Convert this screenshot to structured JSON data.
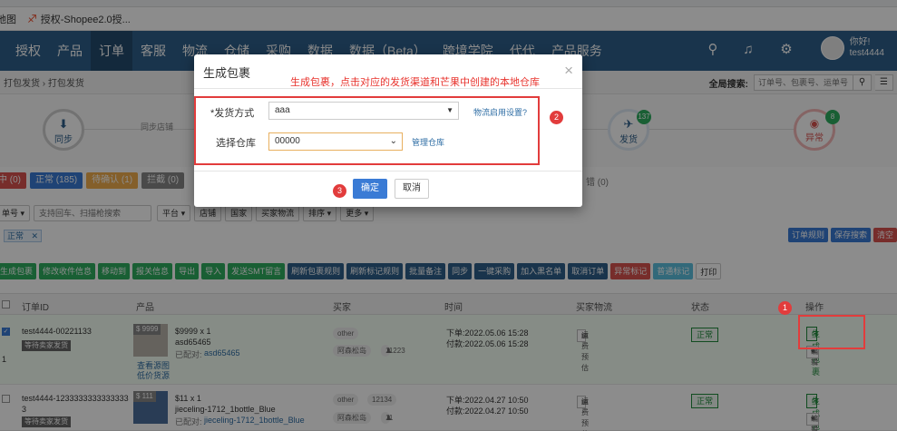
{
  "browser": {
    "bookmarks": [
      {
        "label": "地图"
      },
      {
        "label": "授权-Shopee2.0授..."
      }
    ]
  },
  "nav": {
    "items": [
      "授权",
      "产品",
      "订单",
      "客服",
      "物流",
      "仓储",
      "采购",
      "数据",
      "数据（Beta）",
      "跨境学院",
      "代代",
      "产品服务"
    ],
    "active_index": 2,
    "greeting": "你好!",
    "username": "test4444"
  },
  "breadcrumb": {
    "text": "打包发货 › 打包发货"
  },
  "global_search": {
    "label": "全局搜索:",
    "placeholder": "订单号、包裹号、运单号"
  },
  "workflow": {
    "step1_label": "同步",
    "step1_link": "同步店铺",
    "ship_label": "发货",
    "ship_count": "137",
    "abnormal_label": "异常",
    "abnormal_count": "8"
  },
  "status_tabs": [
    {
      "label": "中 (0)",
      "color": "#d9534f"
    },
    {
      "label": "正常 (185)",
      "color": "#3a7bd5"
    },
    {
      "label": "待确认 (1)",
      "color": "#f0ad4e"
    },
    {
      "label": "拦截 (0)",
      "color": "#888888"
    }
  ],
  "status_tab_right": "错 (0)",
  "filters": {
    "search_placeholder": "支持回车、扫描枪搜索",
    "prefix": "单号",
    "buttons": [
      "平台",
      "店铺",
      "国家",
      "买家物流",
      "排序",
      "更多"
    ],
    "active_tag": "正常"
  },
  "right_buttons": [
    {
      "label": "订单规则",
      "color": "#3a7bd5"
    },
    {
      "label": "保存搜索",
      "color": "#3a7bd5"
    },
    {
      "label": "清空",
      "color": "#d9534f"
    }
  ],
  "actions": [
    {
      "label": "生成包裹",
      "color": "#2eae60"
    },
    {
      "label": "修改收件信息",
      "color": "#2eae60"
    },
    {
      "label": "移动到",
      "color": "#2eae60"
    },
    {
      "label": "报关信息",
      "color": "#2eae60"
    },
    {
      "label": "导出",
      "color": "#2eae60"
    },
    {
      "label": "导入",
      "color": "#2eae60"
    },
    {
      "label": "发送SMT留言",
      "color": "#2eae60"
    },
    {
      "label": "刷新包裹规则",
      "color": "#2e5f8a"
    },
    {
      "label": "刷新标记规则",
      "color": "#2e5f8a"
    },
    {
      "label": "批量备注",
      "color": "#2e5f8a"
    },
    {
      "label": "同步",
      "color": "#2e5f8a"
    },
    {
      "label": "一键采购",
      "color": "#2e5f8a"
    },
    {
      "label": "加入黑名单",
      "color": "#2e5f8a"
    },
    {
      "label": "取消订单",
      "color": "#2e5f8a"
    },
    {
      "label": "异常标记",
      "color": "#d9534f"
    },
    {
      "label": "普通标记",
      "color": "#5bc0de"
    },
    {
      "label": "打印",
      "color": "#ffffff"
    }
  ],
  "table": {
    "headers": [
      "订单ID",
      "产品",
      "买家",
      "时间",
      "买家物流",
      "状态",
      "操作"
    ],
    "rows": [
      {
        "order_id": "test4444-00221133",
        "status_label": "等待卖家发货",
        "price_tag": "$ 9999",
        "price_qty": "$9999 x 1",
        "sku": "asd65465",
        "matched": "已配对:",
        "matched_sku": "asd65465",
        "source1": "查看源图",
        "source2": "低价货源",
        "buyer": "other",
        "buyer_extra": "",
        "buyer_name": "阿森松岛",
        "buyer_count": "11223",
        "order_time": "下单:2022.05.06 15:28",
        "pay_time": "付款:2022.05.06 15:28",
        "shipping": "运费预估",
        "state": "正常",
        "op_primary": "生成包裹",
        "op_secondary": "编辑"
      },
      {
        "order_id": "test4444-1233333333333333",
        "order_id_tail": "3",
        "status_label": "等待卖家发货",
        "price_tag": "$ 111",
        "price_qty": "$11 x 1",
        "sku": "jieceling-1712_1bottle_Blue",
        "matched": "已配对:",
        "matched_sku": "jieceling-1712_1bottle_Blue",
        "buyer": "other",
        "buyer_extra": "12134",
        "buyer_name": "阿森松岛",
        "buyer_count": "11",
        "order_time": "下单:2022.04.27 10:50",
        "pay_time": "付款:2022.04.27 10:50",
        "shipping": "运费预估",
        "state": "正常",
        "op_primary": "生成包裹",
        "op_secondary": "编辑"
      }
    ]
  },
  "modal": {
    "title": "生成包裹",
    "note": "生成包裹，点击对应的发货渠道和芒果中创建的本地仓库",
    "ship_label": "*发货方式",
    "ship_value": "aaa",
    "ship_link": "物流启用设置?",
    "warehouse_label": "选择仓库",
    "warehouse_value": "00000",
    "warehouse_link": "管理仓库",
    "ok": "确定",
    "cancel": "取消"
  },
  "markers": [
    "1",
    "2",
    "3"
  ]
}
